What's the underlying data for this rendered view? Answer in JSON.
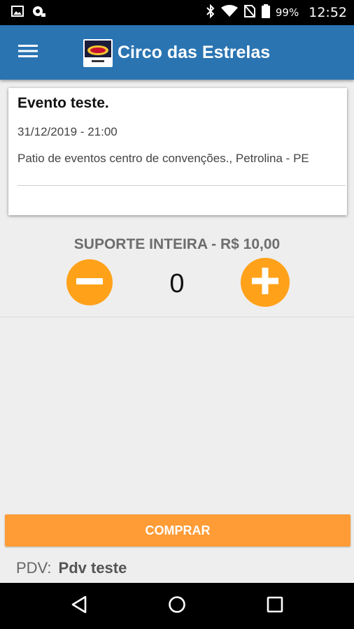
{
  "status_bar": {
    "battery_percent": "99%",
    "time": "12:52",
    "icons": [
      "gallery-icon",
      "camera-icon",
      "bluetooth-icon",
      "wifi-icon",
      "no-sim-icon",
      "battery-icon"
    ]
  },
  "app_bar": {
    "title": "Circo das Estrelas",
    "menu_icon": "menu-icon",
    "logo": "circus-logo"
  },
  "event": {
    "title": "Evento teste.",
    "datetime": "31/12/2019 - 21:00",
    "location": "Patio de eventos centro de convenções., Petrolina - PE"
  },
  "ticket": {
    "label": "SUPORTE INTEIRA - R$ 10,00",
    "quantity": "0",
    "decrement_icon": "minus-icon",
    "increment_icon": "plus-icon"
  },
  "actions": {
    "buy_label": "COMPRAR"
  },
  "pdv": {
    "label": "PDV:",
    "name": "Pdv teste"
  },
  "colors": {
    "app_bar": "#2a74b2",
    "accent": "#ffa21a",
    "buy_button": "#ff9c36"
  },
  "nav_bar": {
    "icons": [
      "back-icon",
      "home-icon",
      "recents-icon"
    ]
  }
}
